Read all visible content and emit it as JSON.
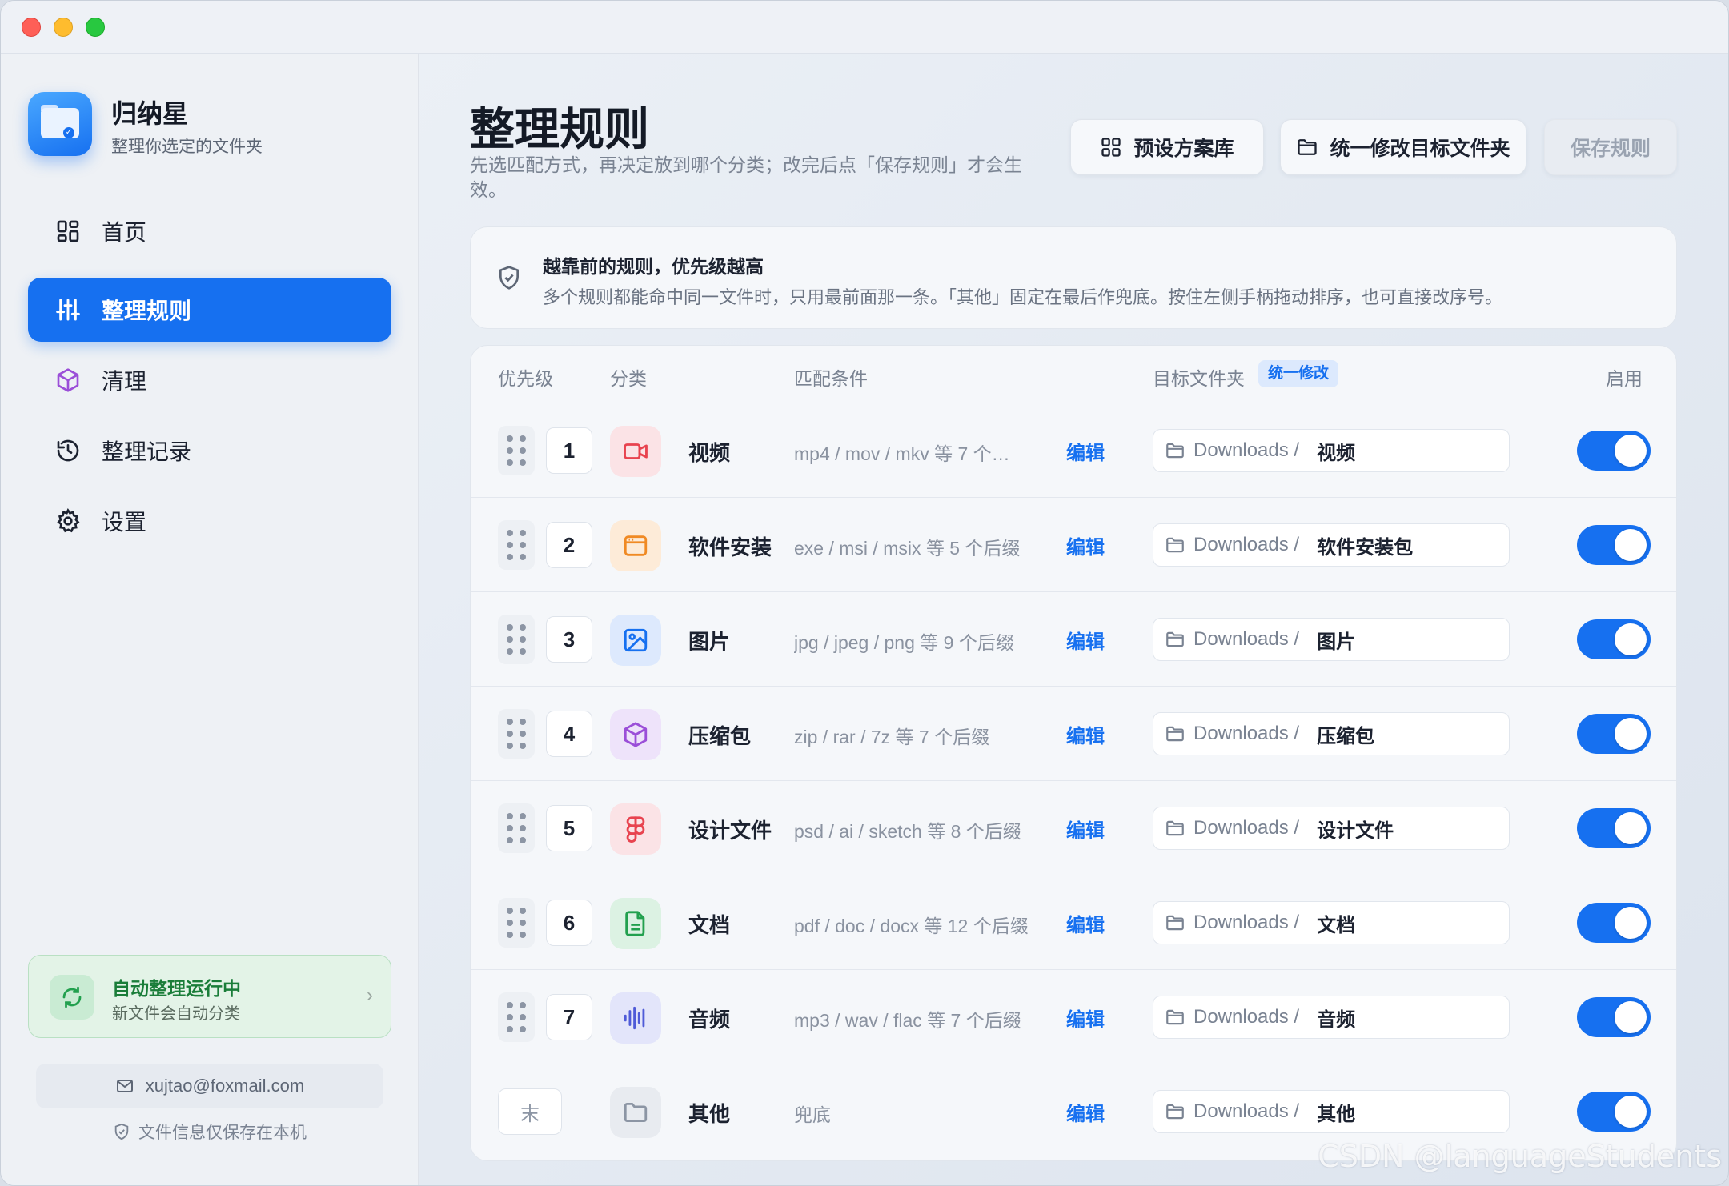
{
  "app": {
    "name": "归纳星",
    "subtitle": "整理你选定的文件夹"
  },
  "nav": [
    {
      "label": "首页",
      "icon": "grid-icon"
    },
    {
      "label": "整理规则",
      "icon": "sliders-icon",
      "active": true
    },
    {
      "label": "清理",
      "icon": "cube-icon"
    },
    {
      "label": "整理记录",
      "icon": "history-icon"
    },
    {
      "label": "设置",
      "icon": "gear-icon"
    }
  ],
  "status": {
    "title": "自动整理运行中",
    "subtitle": "新文件会自动分类",
    "chevron": "›"
  },
  "account": {
    "email": "xujtao@foxmail.com",
    "local_note": "文件信息仅保存在本机"
  },
  "header": {
    "title": "整理规则",
    "description": "先选匹配方式，再决定放到哪个分类；改完后点「保存规则」才会生效。",
    "presets_label": "预设方案库",
    "unify_label": "统一修改目标文件夹",
    "save_label": "保存规则"
  },
  "info": {
    "title": "越靠前的规则，优先级越高",
    "text": "多个规则都能命中同一文件时，只用最前面那一条。「其他」固定在最后作兜底。按住左侧手柄拖动排序，也可直接改序号。"
  },
  "table": {
    "columns": {
      "priority": "优先级",
      "category": "分类",
      "condition": "匹配条件",
      "target": "目标文件夹",
      "unify_badge": "统一修改",
      "enabled": "启用"
    },
    "edit_label": "编辑",
    "rows": [
      {
        "priority": "1",
        "name": "视频",
        "condition": "mp4 / mov / mkv 等 7 个…",
        "path": "Downloads /",
        "dest": "视频",
        "icon": "video-icon",
        "color": "#e8434f",
        "bg": "#fbe3e6",
        "enabled": true
      },
      {
        "priority": "2",
        "name": "软件安装",
        "condition": "exe / msi / msix 等 5 个后缀",
        "path": "Downloads /",
        "dest": "软件安装包",
        "icon": "app-window-icon",
        "color": "#f08a24",
        "bg": "#fdebd8",
        "enabled": true
      },
      {
        "priority": "3",
        "name": "图片",
        "condition": "jpg / jpeg / png 等 9 个后缀",
        "path": "Downloads /",
        "dest": "图片",
        "icon": "image-icon",
        "color": "#1670f0",
        "bg": "#dde9fd",
        "enabled": true
      },
      {
        "priority": "4",
        "name": "压缩包",
        "condition": "zip / rar / 7z 等 7 个后缀",
        "path": "Downloads /",
        "dest": "压缩包",
        "icon": "package-icon",
        "color": "#9b4fd8",
        "bg": "#eee3fa",
        "enabled": true
      },
      {
        "priority": "5",
        "name": "设计文件",
        "condition": "psd / ai / sketch 等 8 个后缀",
        "path": "Downloads /",
        "dest": "设计文件",
        "icon": "figma-icon",
        "color": "#e8434f",
        "bg": "#fbe3e6",
        "enabled": true
      },
      {
        "priority": "6",
        "name": "文档",
        "condition": "pdf / doc / docx 等 12 个后缀",
        "path": "Downloads /",
        "dest": "文档",
        "icon": "document-icon",
        "color": "#22a04e",
        "bg": "#dcf2e3",
        "enabled": true
      },
      {
        "priority": "7",
        "name": "音频",
        "condition": "mp3 / wav / flac 等 7 个后缀",
        "path": "Downloads /",
        "dest": "音频",
        "icon": "audio-wave-icon",
        "color": "#4f5bd8",
        "bg": "#e3e5fa",
        "enabled": true
      },
      {
        "priority": "末",
        "name": "其他",
        "condition": "兜底",
        "path": "Downloads /",
        "dest": "其他",
        "icon": "folder-icon",
        "color": "#8c95a4",
        "bg": "#e8ebf0",
        "enabled": true
      }
    ]
  },
  "watermark": "CSDN @languageStudents"
}
